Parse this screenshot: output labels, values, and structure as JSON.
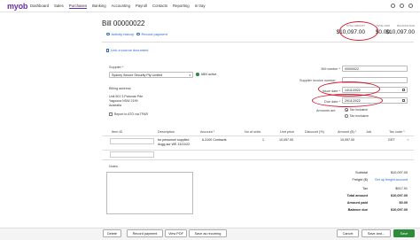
{
  "nav": {
    "logo": "myob",
    "items": [
      "Dashboard",
      "Sales",
      "Purchases",
      "Banking",
      "Accounting",
      "Payroll",
      "Contacts",
      "Reporting",
      "In tray"
    ]
  },
  "header": {
    "title": "Bill 00000022",
    "activity_link": "Activity history",
    "record_payment_link": "Record payment",
    "totals": [
      {
        "label": "TOTAL AMOUNT",
        "value": "$10,097.00"
      },
      {
        "label": "TOTAL PAID",
        "value": "$0.00"
      },
      {
        "label": "BALANCE DUE",
        "value": "$10,097.00"
      }
    ]
  },
  "link_source": "Link a source document",
  "supplier": {
    "label": "Supplier *",
    "value": "Sydney Secure Security Pty Limited",
    "abn": "ABN active",
    "billing_label": "Billing address",
    "address": [
      "Unit 501 3 Palomar Pde",
      "Yagoona NSW 2199",
      "Australia"
    ],
    "report_ato": "Report to ATO via TPAR"
  },
  "bill": {
    "number_label": "Bill number *",
    "number": "00000022",
    "invoice_label": "Supplier invoice number",
    "invoice": "",
    "issue_label": "Issue date *",
    "issue": "14/11/2022",
    "due_label": "Due date *",
    "due": "29/11/2022",
    "amounts_label": "Amounts are",
    "tax_inclusive": "Tax inclusive",
    "tax_exclusive": "Tax exclusive"
  },
  "table": {
    "headers": [
      "Item ID",
      "Description",
      "Account *",
      "No of units",
      "Unit price",
      "Discount (%)",
      "Amount ($) *",
      "Job",
      "Tax code *"
    ],
    "rows": [
      {
        "item": "",
        "desc1": "for personnel supplied",
        "desc2": "Augg-sur WE 13/11/22",
        "account": "6-3100 Contracts",
        "units": "1",
        "price": "10,097.00",
        "discount": "",
        "amount": "10,097.00",
        "job": "",
        "tax": "GST"
      }
    ]
  },
  "notes_label": "Notes",
  "summary": [
    {
      "label": "Subtotal",
      "value": "$10,097.00",
      "bold": false
    },
    {
      "label": "Freight ($)",
      "value": "Set up freight account",
      "bold": false
    },
    {
      "label": "Tax",
      "value": "$917.91",
      "bold": false
    },
    {
      "label": "Total amount",
      "value": "$10,097.00",
      "bold": true
    },
    {
      "label": "Amount paid",
      "value": "$0.00",
      "bold": true
    },
    {
      "label": "Balance due",
      "value": "$10,097.00",
      "bold": true
    }
  ],
  "buttons": {
    "delete": "Delete",
    "record_payment": "Record payment",
    "view_pdf": "View PDF",
    "save_recurring": "Save as recurring",
    "cancel": "Cancel",
    "save_and": "Save and...",
    "save": "Save"
  },
  "colors": {
    "brand": "#6c2ea8",
    "link": "#2a6bc7",
    "highlight": "#d0192f",
    "primary": "#2e8b3b"
  }
}
